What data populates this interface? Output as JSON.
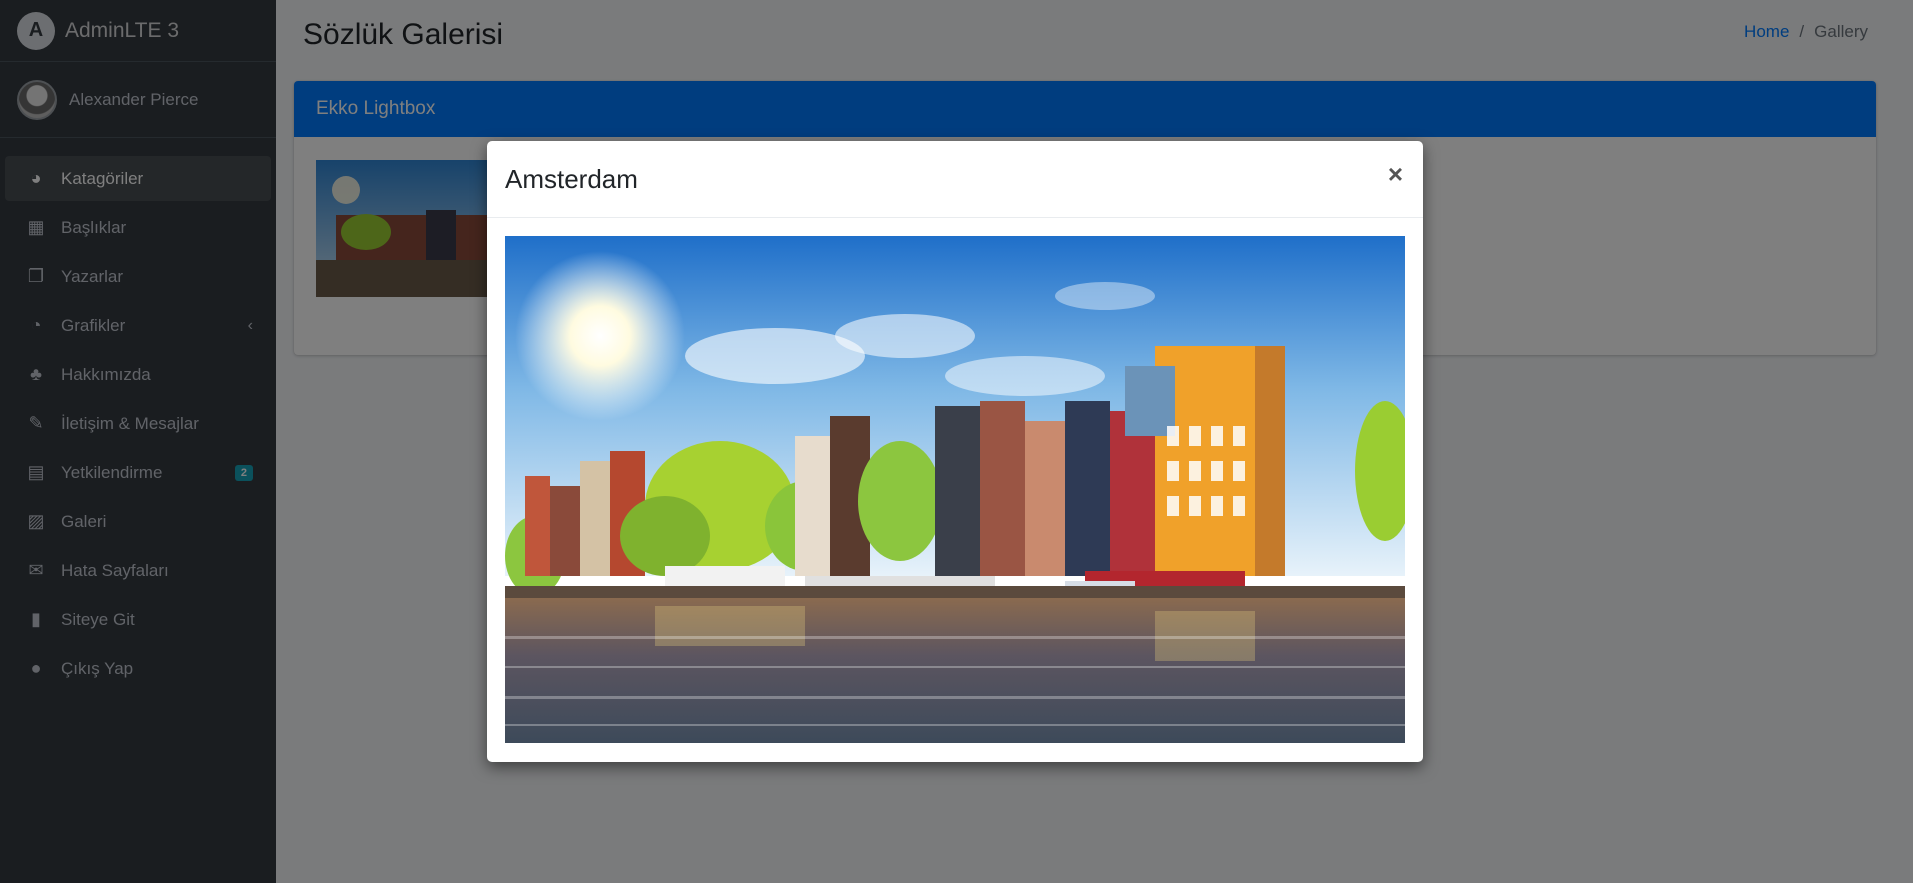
{
  "brand": {
    "logo_letter": "A",
    "name": "AdminLTE 3"
  },
  "user": {
    "name": "Alexander Pierce"
  },
  "nav": {
    "items": [
      {
        "label": "Katagöriler",
        "icon": "tachometer-icon",
        "glyph": "◕"
      },
      {
        "label": "Başlıklar",
        "icon": "grid-icon",
        "glyph": "▦"
      },
      {
        "label": "Yazarlar",
        "icon": "copy-icon",
        "glyph": "❐"
      },
      {
        "label": "Grafikler",
        "icon": "pie-chart-icon",
        "glyph": "◔",
        "caret": "‹"
      },
      {
        "label": "Hakkımızda",
        "icon": "tree-icon",
        "glyph": "♣"
      },
      {
        "label": "İletişim & Mesajlar",
        "icon": "edit-icon",
        "glyph": "✎"
      },
      {
        "label": "Yetkilendirme",
        "icon": "calendar-icon",
        "glyph": "▤",
        "badge": "2"
      },
      {
        "label": "Galeri",
        "icon": "image-icon",
        "glyph": "▨"
      },
      {
        "label": "Hata Sayfaları",
        "icon": "envelope-icon",
        "glyph": "✉"
      },
      {
        "label": "Siteye Git",
        "icon": "book-icon",
        "glyph": "▮"
      },
      {
        "label": "Çıkış Yap",
        "icon": "apple-icon",
        "glyph": "●"
      }
    ]
  },
  "page": {
    "title": "Sözlük Galerisi"
  },
  "breadcrumb": {
    "home": "Home",
    "separator": "/",
    "current": "Gallery"
  },
  "card": {
    "title": "Ekko Lightbox"
  },
  "modal": {
    "title": "Amsterdam",
    "close": "×"
  },
  "colors": {
    "sidebar_bg": "#343a40",
    "primary": "#007bff",
    "badge": "#17a2b8"
  }
}
